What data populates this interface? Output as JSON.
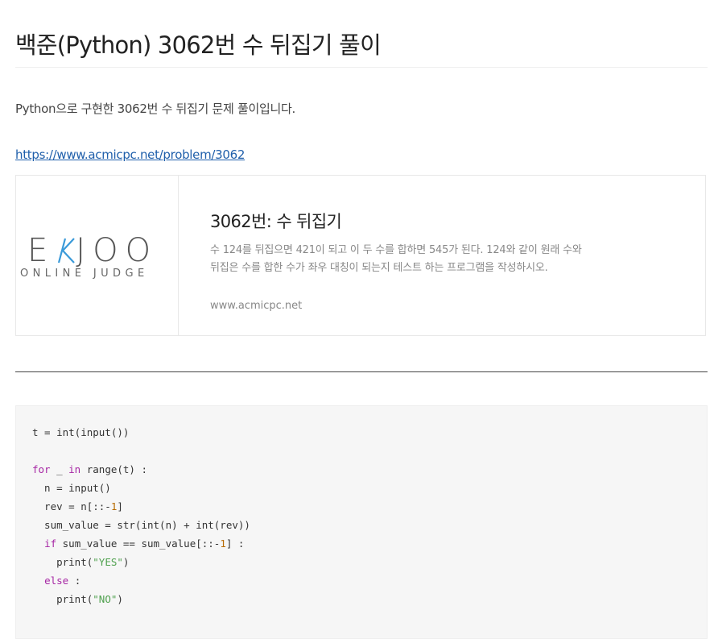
{
  "post": {
    "title": "백준(Python) 3062번 수 뒤집기 풀이",
    "intro": "Python으로 구현한 3062번 수 뒤집기 문제 풀이입니다.",
    "link": "https://www.acmicpc.net/problem/3062"
  },
  "link_card": {
    "logo": {
      "left": "E",
      "k": "K",
      "right": "JOO",
      "subtitle": "ONLINE JUDGE",
      "accent": "#3a9ad9"
    },
    "title": "3062번: 수 뒤집기",
    "description": "수 124를 뒤집으면 421이 되고 이 두 수를 합하면 545가 된다. 124와 같이 원래 수와 뒤집은 수를 합한 수가 좌우 대칭이 되는지 테스트 하는 프로그램을 작성하시오.",
    "domain": "www.acmicpc.net"
  },
  "code_block": {
    "language": "python",
    "lines": [
      [
        {
          "t": "t = int(input())",
          "c": ""
        }
      ],
      [
        {
          "t": "",
          "c": ""
        }
      ],
      [
        {
          "t": "for",
          "c": "kw"
        },
        {
          "t": " _ ",
          "c": ""
        },
        {
          "t": "in",
          "c": "kw"
        },
        {
          "t": " range(t) :",
          "c": ""
        }
      ],
      [
        {
          "t": "  n = input()",
          "c": ""
        }
      ],
      [
        {
          "t": "  rev = n[::-",
          "c": ""
        },
        {
          "t": "1",
          "c": "num"
        },
        {
          "t": "]",
          "c": ""
        }
      ],
      [
        {
          "t": "  sum_value = str(int(n) + int(rev))",
          "c": ""
        }
      ],
      [
        {
          "t": "  ",
          "c": ""
        },
        {
          "t": "if",
          "c": "kw"
        },
        {
          "t": " sum_value == sum_value[::-",
          "c": ""
        },
        {
          "t": "1",
          "c": "num"
        },
        {
          "t": "] :",
          "c": ""
        }
      ],
      [
        {
          "t": "    print(",
          "c": ""
        },
        {
          "t": "\"YES\"",
          "c": "str"
        },
        {
          "t": ")",
          "c": ""
        }
      ],
      [
        {
          "t": "  ",
          "c": ""
        },
        {
          "t": "else",
          "c": "kw"
        },
        {
          "t": " :",
          "c": ""
        }
      ],
      [
        {
          "t": "    print(",
          "c": ""
        },
        {
          "t": "\"NO\"",
          "c": "str"
        },
        {
          "t": ")",
          "c": ""
        }
      ]
    ]
  }
}
